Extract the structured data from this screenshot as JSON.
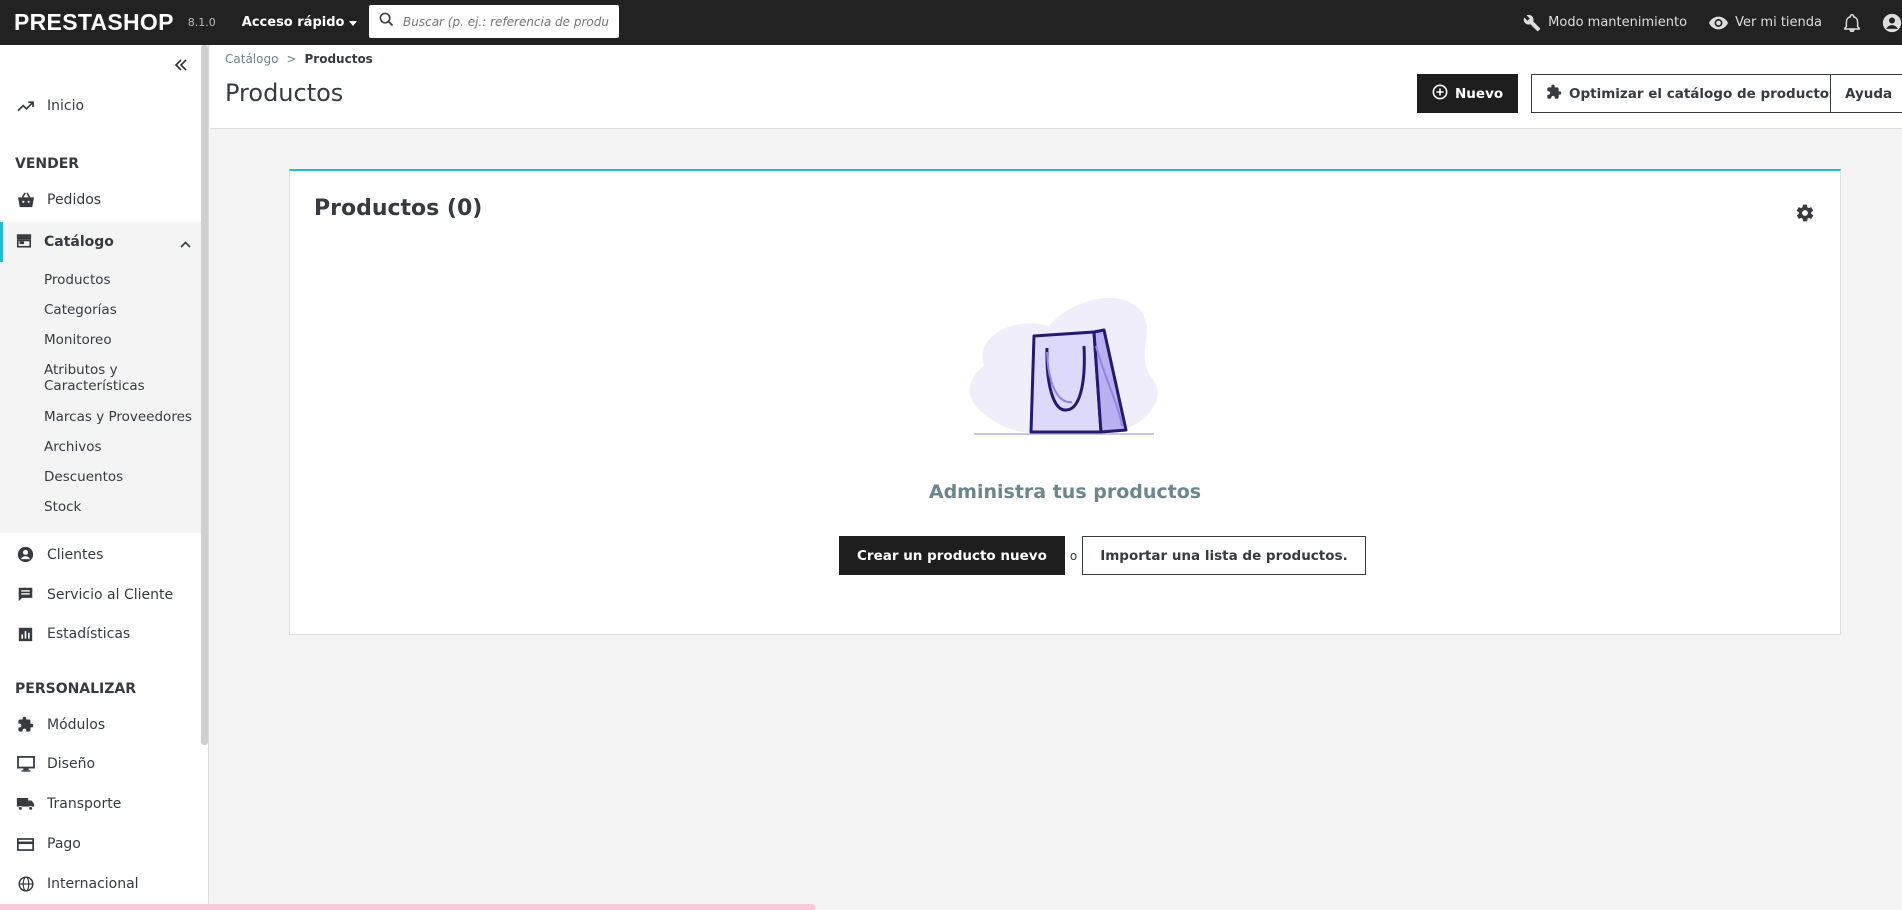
{
  "topbar": {
    "logo": "PRESTASHOP",
    "version": "8.1.0",
    "quick_access": "Acceso rápido",
    "search_placeholder": "Buscar (p. ej.: referencia de producto, nombre de cliente...)",
    "maintenance": "Modo mantenimiento",
    "view_store": "Ver mi tienda"
  },
  "sidebar": {
    "home": "Inicio",
    "section_sell": "VENDER",
    "orders": "Pedidos",
    "catalog": "Catálogo",
    "catalog_items": [
      "Productos",
      "Categorías",
      "Monitoreo",
      "Atributos y Características",
      "Marcas y Proveedores",
      "Archivos",
      "Descuentos",
      "Stock"
    ],
    "customers": "Clientes",
    "customer_service": "Servicio al Cliente",
    "stats": "Estadísticas",
    "section_customize": "PERSONALIZAR",
    "modules": "Módulos",
    "design": "Diseño",
    "shipping": "Transporte",
    "payment": "Pago",
    "international": "Internacional"
  },
  "header": {
    "breadcrumb": [
      "Catálogo",
      "Productos"
    ],
    "breadcrumb_sep": ">",
    "title": "Productos",
    "new_button": "Nuevo",
    "optimize_button": "Optimizar el catálogo de productos",
    "help_button": "Ayuda"
  },
  "card": {
    "title": "Productos (0)",
    "empty_title": "Administra tus productos",
    "create_button": "Crear un producto nuevo",
    "or": "o",
    "import_button": "Importar una lista de productos."
  },
  "colors": {
    "topbar": "#222222",
    "accent": "#25b9d7",
    "illustration_purple": "#5b4fd1",
    "illustration_light": "#d9d5fa"
  }
}
